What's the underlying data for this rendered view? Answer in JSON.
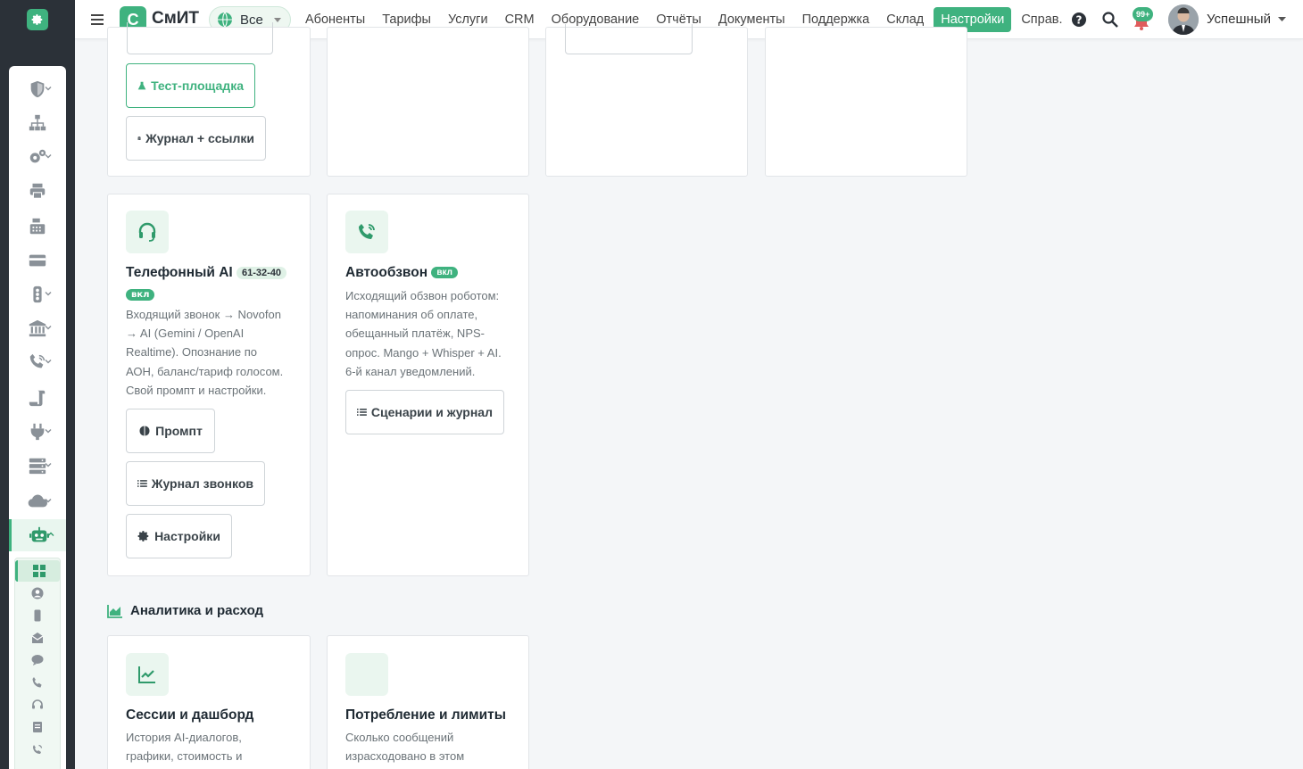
{
  "app": {
    "brand_letter": "С",
    "brand_name": "СмИТ",
    "scope": "Все"
  },
  "nav": [
    {
      "label": "Абоненты"
    },
    {
      "label": "Тарифы"
    },
    {
      "label": "Услуги"
    },
    {
      "label": "CRM"
    },
    {
      "label": "Оборудование"
    },
    {
      "label": "Отчёты"
    },
    {
      "label": "Документы"
    },
    {
      "label": "Поддержка"
    },
    {
      "label": "Склад"
    },
    {
      "label": "Настройки",
      "active": true
    },
    {
      "label": "Справ."
    }
  ],
  "topbar": {
    "notif_count": "99+",
    "user_name": "Успешный"
  },
  "cards_top": {
    "c1": {
      "btn_test": "Тест-площадка",
      "btn_journal": "Журнал + ссылки"
    }
  },
  "card_phone_ai": {
    "title": "Телефонный AI",
    "number": "61-32-40",
    "status": "вкл",
    "desc": [
      "Входящий звонок → Novofon",
      "→ AI (Gemini / OpenAI",
      "Realtime). Опознание по",
      "АОН, баланс/тариф голосом.",
      "Свой промпт и настройки."
    ],
    "btn_prompt": "Промпт",
    "btn_calls": "Журнал звонков",
    "btn_settings": "Настройки"
  },
  "card_autocall": {
    "title": "Автообзвон",
    "status": "вкл",
    "desc": [
      "Исходящий обзвон роботом:",
      "напоминания об оплате,",
      "обещанный платёж, NPS-",
      "опрос. Mango + Whisper + AI.",
      "6-й канал уведомлений."
    ],
    "btn_scenarios": "Сценарии и журнал"
  },
  "section_analytics": {
    "title": "Аналитика и расход"
  },
  "card_sessions": {
    "title": "Сессии и дашборд",
    "desc": [
      "История AI-диалогов,",
      "графики, стоимость и"
    ]
  },
  "card_usage": {
    "title": "Потребление и лимиты",
    "desc": [
      "Сколько сообщений",
      "израсходовано в этом"
    ]
  },
  "colors": {
    "accent": "#3fb27f",
    "sidebar_bg": "#2b3138"
  }
}
